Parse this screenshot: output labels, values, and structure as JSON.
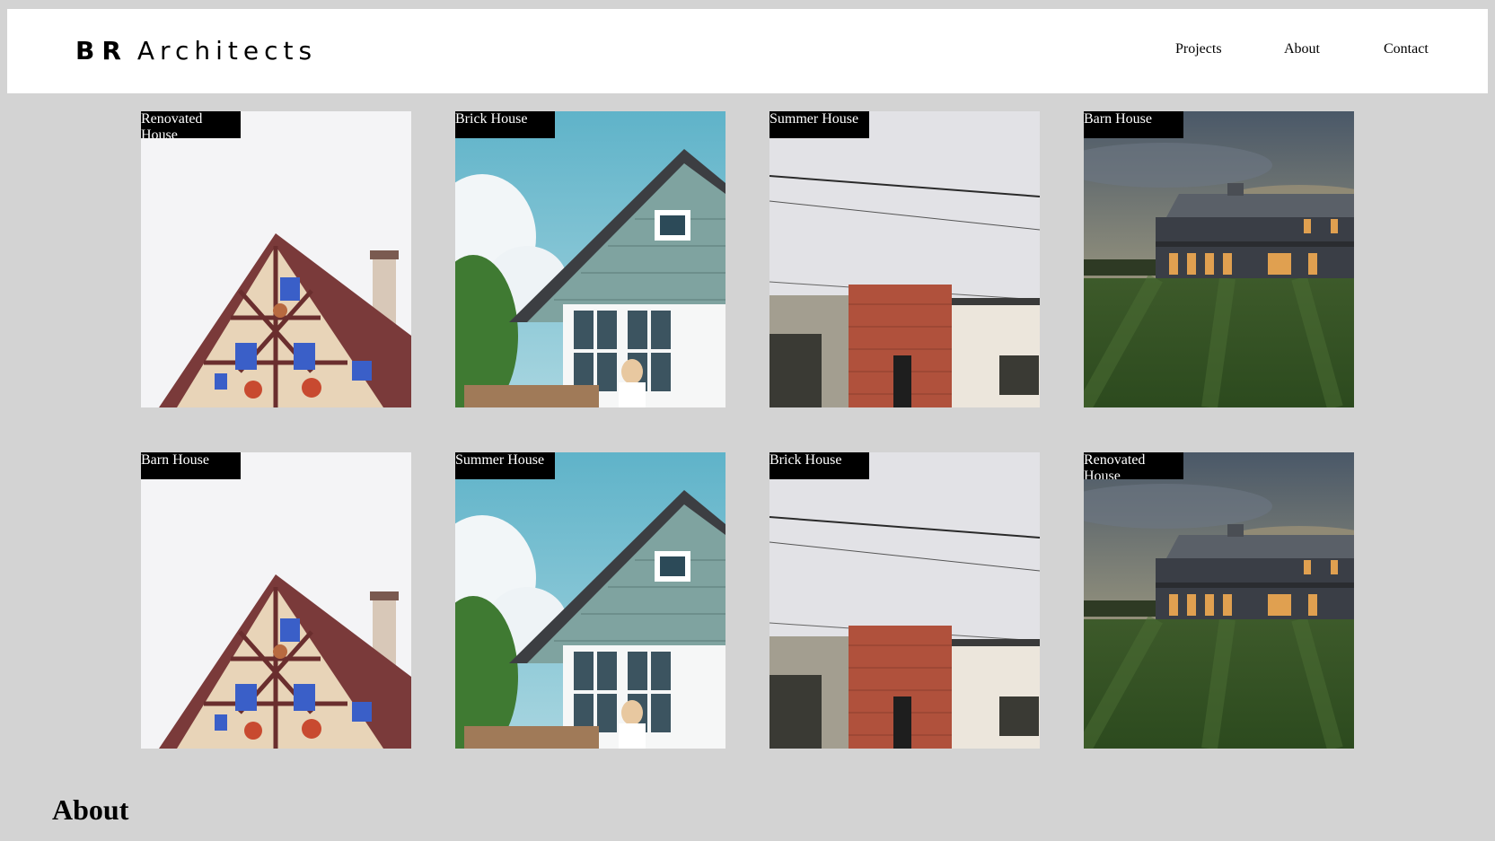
{
  "header": {
    "logo_bold": "BR",
    "logo_rest": "Architects",
    "nav": {
      "projects": "Projects",
      "about": "About",
      "contact": "Contact"
    }
  },
  "projects": [
    {
      "label": "Renovated House",
      "image": "timber-frame-house"
    },
    {
      "label": "Brick House",
      "image": "green-cottage"
    },
    {
      "label": "Summer House",
      "image": "brick-facade"
    },
    {
      "label": "Barn House",
      "image": "barn-at-dusk"
    },
    {
      "label": "Barn House",
      "image": "timber-frame-house"
    },
    {
      "label": "Summer House",
      "image": "green-cottage"
    },
    {
      "label": "Brick House",
      "image": "brick-facade"
    },
    {
      "label": "Renovated House",
      "image": "barn-at-dusk"
    }
  ],
  "about": {
    "heading": "About"
  },
  "colors": {
    "background": "#d3d3d3",
    "header": "#ffffff",
    "tag_bg": "#000000",
    "tag_text": "#ffffff"
  }
}
